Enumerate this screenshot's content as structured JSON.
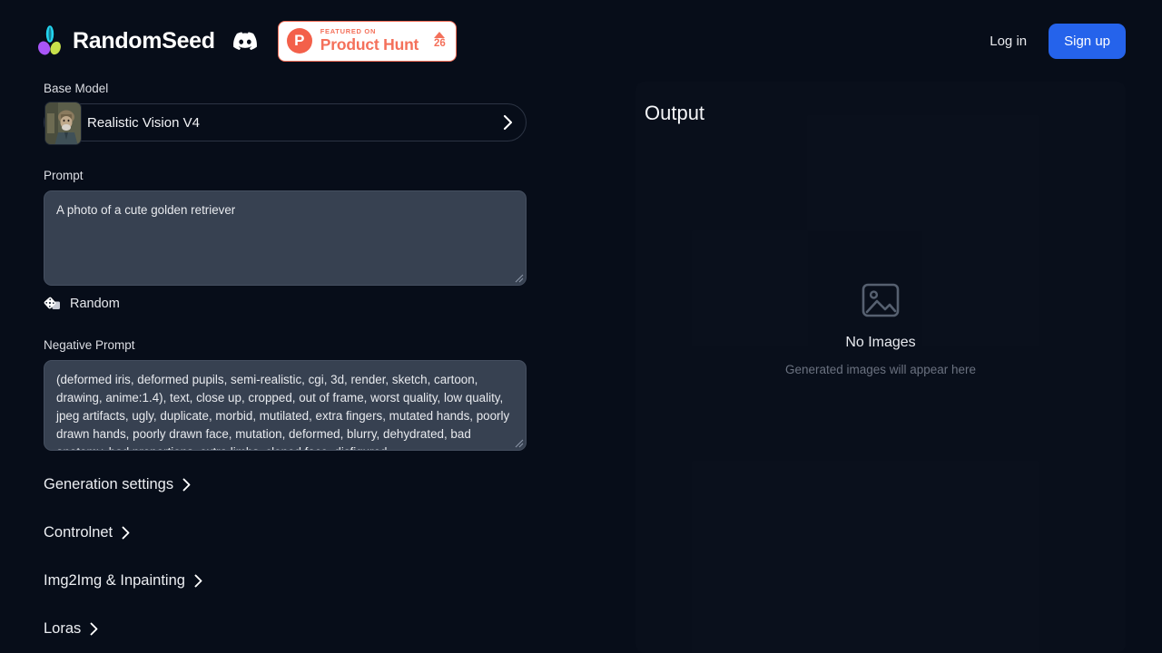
{
  "header": {
    "brand_name": "RandomSeed",
    "logo_icon": "seedling-icon",
    "discord_icon": "discord-icon",
    "product_hunt": {
      "logo_letter": "P",
      "featured_on": "FEATURED ON",
      "name": "Product Hunt",
      "upvote_icon": "triangle-up-icon",
      "count": "26"
    },
    "login_label": "Log in",
    "signup_label": "Sign up",
    "accent_blue": "#2563eb",
    "product_hunt_color": "#f4705a"
  },
  "form": {
    "base_model_label": "Base Model",
    "base_model_value": "Realistic Vision V4",
    "base_model_chevron": "chevron-right-icon",
    "prompt_label": "Prompt",
    "prompt_value": "A photo of a cute golden retriever",
    "prompt_placeholder": "",
    "random_icon": "dice-icon",
    "random_label": "Random",
    "negative_prompt_label": "Negative Prompt",
    "negative_prompt_value": "(deformed iris, deformed pupils, semi-realistic, cgi, 3d, render, sketch, cartoon, drawing, anime:1.4), text, close up, cropped, out of frame, worst quality, low quality, jpeg artifacts, ugly, duplicate, morbid, mutilated, extra fingers, mutated hands, poorly drawn hands, poorly drawn face, mutation, deformed, blurry, dehydrated, bad anatomy, bad proportions, extra limbs, cloned face, disfigured",
    "negative_prompt_placeholder": ""
  },
  "sections": [
    {
      "label": "Generation settings",
      "chevron": "chevron-right-icon"
    },
    {
      "label": "Controlnet",
      "chevron": "chevron-right-icon"
    },
    {
      "label": "Img2Img & Inpainting",
      "chevron": "chevron-right-icon"
    },
    {
      "label": "Loras",
      "chevron": "chevron-right-icon"
    }
  ],
  "output": {
    "title": "Output",
    "empty_icon": "image-placeholder-icon",
    "empty_title": "No Images",
    "empty_subtitle": "Generated images will appear here"
  }
}
